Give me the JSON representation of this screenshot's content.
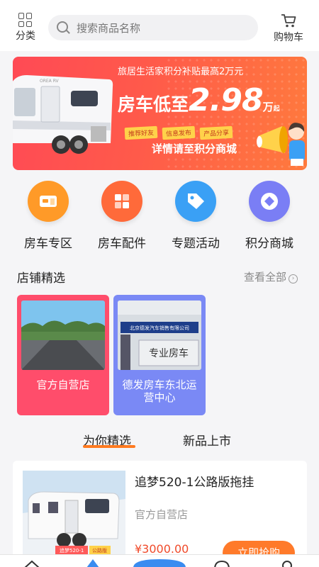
{
  "header": {
    "category_label": "分类",
    "search_placeholder": "搜索商品名称",
    "cart_label": "购物车"
  },
  "banner": {
    "top_line": "旅居生活家积分补贴最高2万元",
    "main_prefix": "房车低至",
    "main_number": "2.98",
    "main_unit": "万",
    "main_suffix": "起",
    "tags": [
      "推荐好友",
      "信息发布",
      "产品分享"
    ],
    "subtitle": "详情请至积分商城",
    "rv_text": "OREA RV"
  },
  "categories": [
    {
      "label": "房车专区",
      "icon": "rv-zone-icon",
      "color": "#ff9a28"
    },
    {
      "label": "房车配件",
      "icon": "parts-grid-icon",
      "color": "#ff6a3a"
    },
    {
      "label": "专题活动",
      "icon": "tag-icon",
      "color": "#3aa0f5"
    },
    {
      "label": "积分商城",
      "icon": "diamond-icon",
      "color": "#7a7ef5"
    }
  ],
  "stores": {
    "heading": "店铺精选",
    "see_all": "查看全部",
    "items": [
      {
        "name": "官方自营店",
        "color": "#ff4d6b"
      },
      {
        "name": "德发房车东北运营中心",
        "color": "#7a89f5",
        "sign_top": "北京德发汽车销售有限公司",
        "sign_main": "专业房车"
      }
    ]
  },
  "feed_tabs": {
    "active": "为你精选",
    "other": "新品上市"
  },
  "product": {
    "title": "追梦520-1公路版拖挂",
    "shop": "官方自营店",
    "price": "¥3000.00",
    "buy_label": "立即抢购",
    "img_tags": [
      "追梦520-1",
      "公路版"
    ]
  },
  "tabbar": {
    "icons": [
      "home-icon",
      "find-icon",
      "center-icon",
      "message-icon",
      "profile-icon"
    ]
  }
}
